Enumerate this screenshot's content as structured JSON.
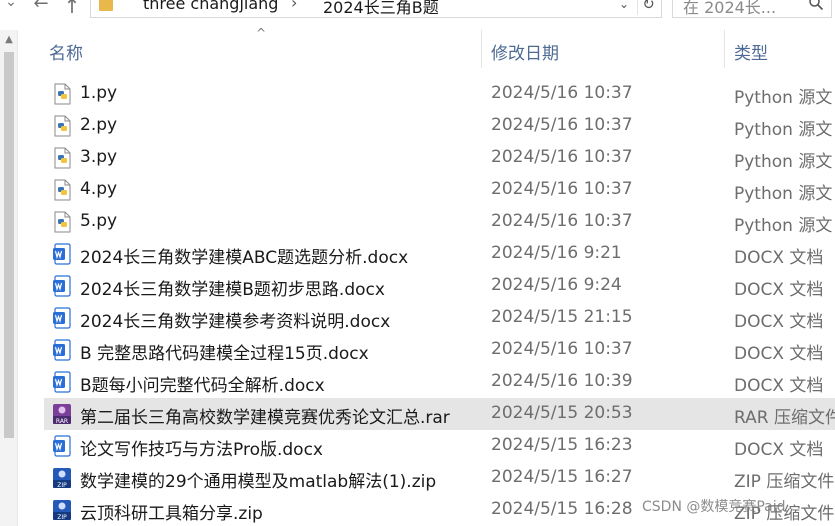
{
  "address_bar": {
    "breadcrumbs": [
      "three changjiang",
      "2024长三角B题"
    ],
    "separator": "›",
    "search_placeholder": "在 2024长...",
    "icons": [
      "chevron-down-icon",
      "back-arrow-icon",
      "up-arrow-icon",
      "folder-icon",
      "dropdown-icon",
      "refresh-icon",
      "search-icon"
    ]
  },
  "columns": {
    "name": "名称",
    "date": "修改日期",
    "type": "类型"
  },
  "files": [
    {
      "name": "1.py",
      "date": "2024/5/16 10:37",
      "type": "Python 源文",
      "icon": "python-file-icon"
    },
    {
      "name": "2.py",
      "date": "2024/5/16 10:37",
      "type": "Python 源文",
      "icon": "python-file-icon"
    },
    {
      "name": "3.py",
      "date": "2024/5/16 10:37",
      "type": "Python 源文",
      "icon": "python-file-icon"
    },
    {
      "name": "4.py",
      "date": "2024/5/16 10:37",
      "type": "Python 源文",
      "icon": "python-file-icon"
    },
    {
      "name": "5.py",
      "date": "2024/5/16 10:37",
      "type": "Python 源文",
      "icon": "python-file-icon"
    },
    {
      "name": "2024长三角数学建模ABC题选题分析.docx",
      "date": "2024/5/16 9:21",
      "type": "DOCX 文档",
      "icon": "word-doc-icon"
    },
    {
      "name": "2024长三角数学建模B题初步思路.docx",
      "date": "2024/5/16 9:24",
      "type": "DOCX 文档",
      "icon": "word-doc-icon"
    },
    {
      "name": "2024长三角数学建模参考资料说明.docx",
      "date": "2024/5/15 21:15",
      "type": "DOCX 文档",
      "icon": "word-doc-icon"
    },
    {
      "name": "B 完整思路代码建模全过程15页.docx",
      "date": "2024/5/16 10:37",
      "type": "DOCX 文档",
      "icon": "word-doc-icon"
    },
    {
      "name": "B题每小问完整代码全解析.docx",
      "date": "2024/5/16 10:39",
      "type": "DOCX 文档",
      "icon": "word-doc-icon"
    },
    {
      "name": "第二届长三角高校数学建模竞赛优秀论文汇总.rar",
      "date": "2024/5/15 20:53",
      "type": "RAR 压缩文件",
      "icon": "rar-archive-icon",
      "selected": true
    },
    {
      "name": "论文写作技巧与方法Pro版.docx",
      "date": "2024/5/15 16:23",
      "type": "DOCX 文档",
      "icon": "word-doc-icon"
    },
    {
      "name": "数学建模的29个通用模型及matlab解法(1).zip",
      "date": "2024/5/15 16:27",
      "type": "ZIP 压缩文件",
      "icon": "zip-archive-icon"
    },
    {
      "name": "云顶科研工具箱分享.zip",
      "date": "2024/5/15 16:28",
      "type": "ZIP 压缩文件",
      "icon": "zip-archive-icon"
    }
  ],
  "watermark": "CSDN @数模竞赛Paid",
  "colors": {
    "header_text": "#4d6a94",
    "selected_row": "#e5e5e5",
    "python_blue": "#3b73b9",
    "python_yellow": "#f2c53d",
    "word_blue": "#2b6fd6",
    "rar_purple": "#7b3f98",
    "zip_blue": "#2459b8"
  }
}
